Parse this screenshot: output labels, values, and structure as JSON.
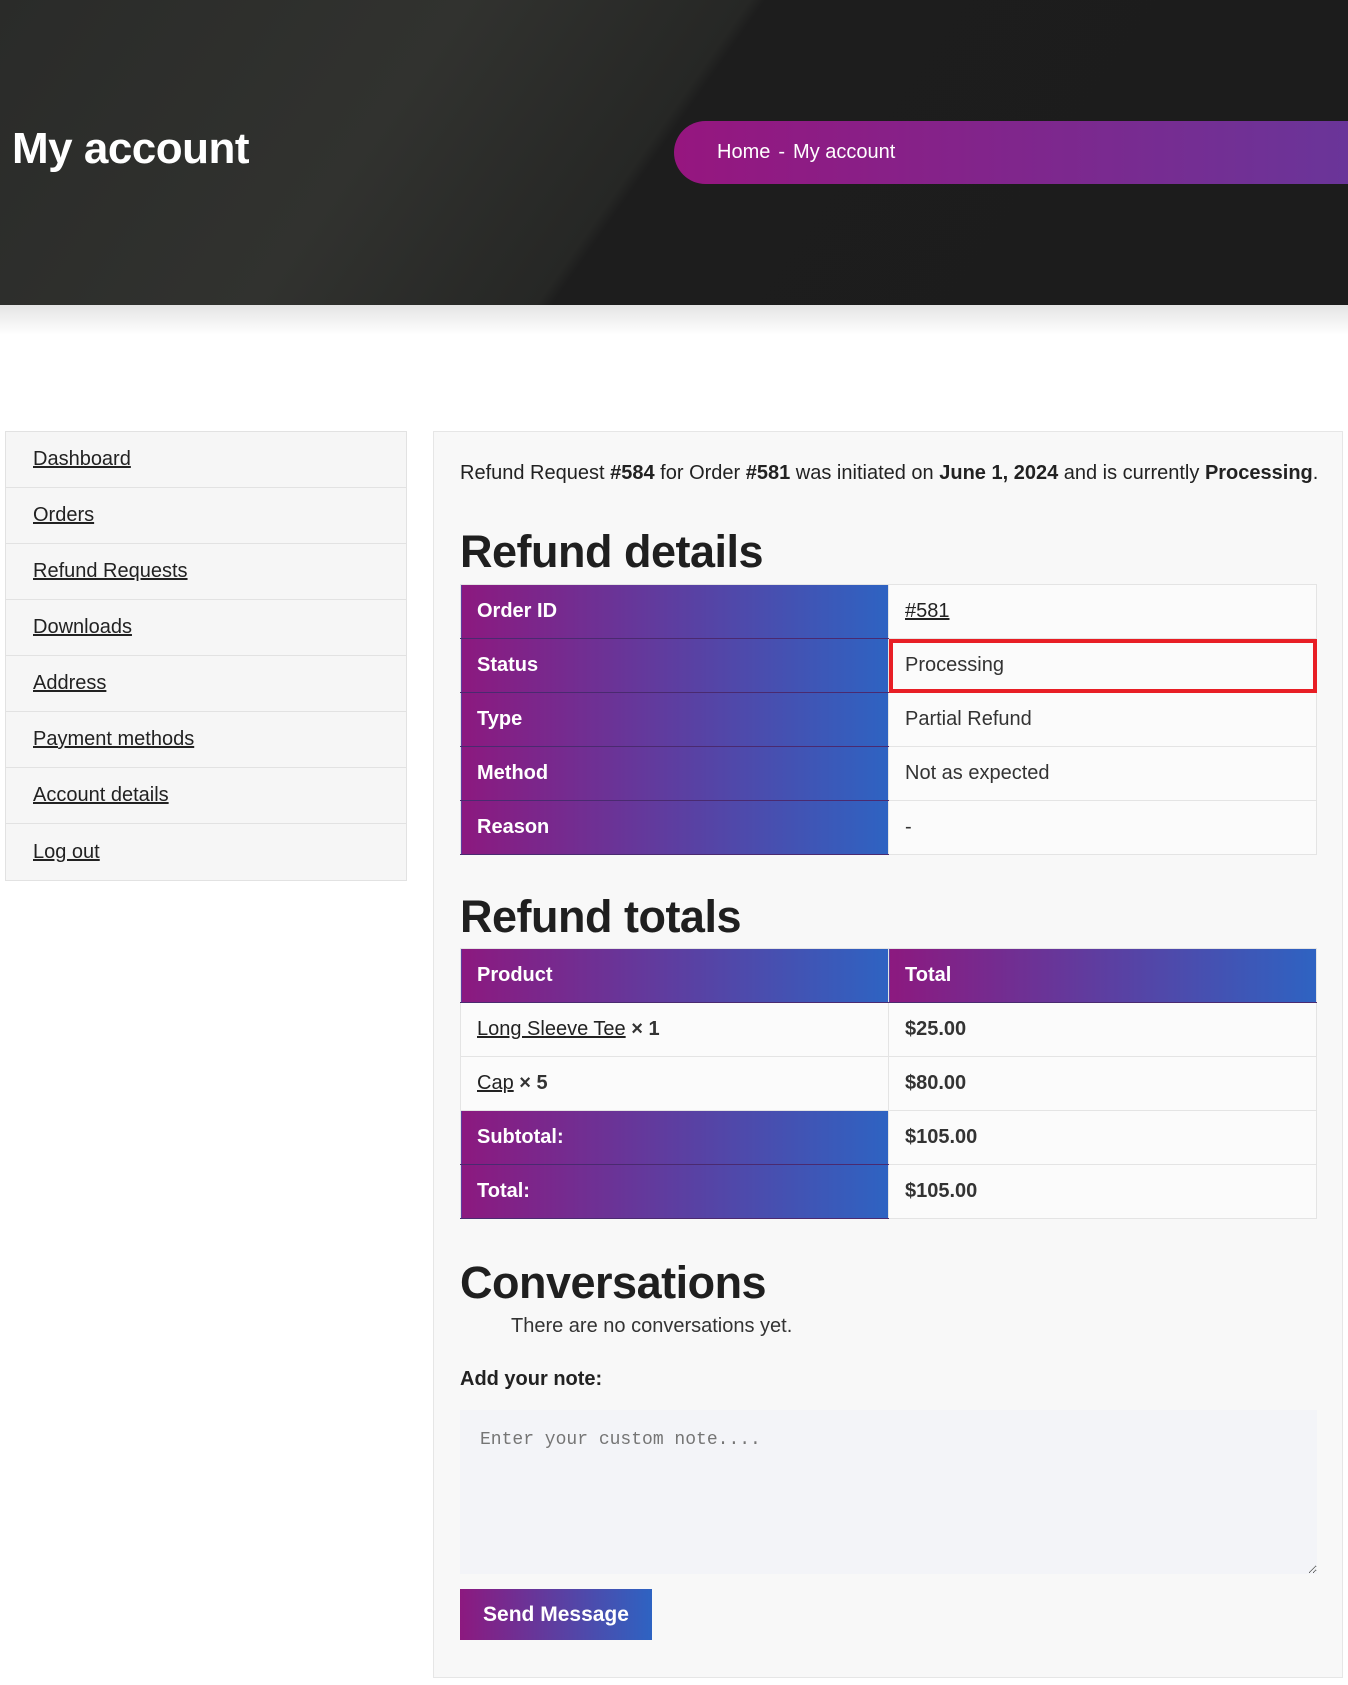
{
  "header": {
    "title": "My account",
    "breadcrumb": {
      "home": "Home",
      "separator": "-",
      "current": "My account"
    }
  },
  "sidebar": {
    "items": [
      {
        "label": "Dashboard"
      },
      {
        "label": "Orders"
      },
      {
        "label": "Refund Requests"
      },
      {
        "label": "Downloads"
      },
      {
        "label": "Address"
      },
      {
        "label": "Payment methods"
      },
      {
        "label": "Account details"
      },
      {
        "label": "Log out"
      }
    ]
  },
  "intro": {
    "p1": "Refund Request ",
    "request_id": "#584",
    "p2": " for Order ",
    "order_id": "#581",
    "p3": " was initiated on ",
    "date": "June 1, 2024",
    "p4": " and is currently ",
    "status": "Processing",
    "p5": "."
  },
  "details": {
    "heading": "Refund details",
    "rows": [
      {
        "label": "Order ID",
        "value": "#581"
      },
      {
        "label": "Status",
        "value": "Processing"
      },
      {
        "label": "Type",
        "value": "Partial Refund"
      },
      {
        "label": "Method",
        "value": "Not as expected"
      },
      {
        "label": "Reason",
        "value": "-"
      }
    ]
  },
  "totals": {
    "heading": "Refund totals",
    "col_product": "Product",
    "col_total": "Total",
    "items": [
      {
        "name": "Long Sleeve Tee",
        "qty": "× 1",
        "total": "$25.00"
      },
      {
        "name": "Cap",
        "qty": "× 5",
        "total": "$80.00"
      }
    ],
    "subtotal_label": "Subtotal:",
    "subtotal": "$105.00",
    "total_label": "Total:",
    "total": "$105.00"
  },
  "conversations": {
    "heading": "Conversations",
    "empty": "There are no conversations yet.",
    "note_label": "Add your note:",
    "placeholder": "Enter your custom note....",
    "send": "Send Message"
  },
  "colors": {
    "gradient_start": "#8c197f",
    "gradient_end": "#2e63c2",
    "highlight": "#e81e25"
  }
}
